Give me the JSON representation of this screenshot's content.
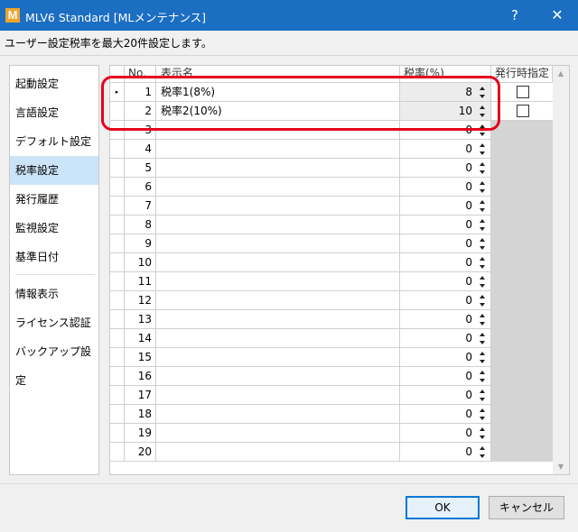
{
  "window": {
    "app_icon": "M",
    "title": "MLV6 Standard [MLメンテナンス]",
    "help": "?",
    "close": "✕"
  },
  "description": "ユーザー設定税率を最大20件設定します。",
  "sidebar": {
    "items": [
      {
        "label": "起動設定",
        "selected": false
      },
      {
        "label": "言語設定",
        "selected": false
      },
      {
        "label": "デフォルト設定",
        "selected": false
      },
      {
        "label": "税率設定",
        "selected": true
      },
      {
        "label": "発行履歴",
        "selected": false
      },
      {
        "label": "監視設定",
        "selected": false
      },
      {
        "label": "基準日付",
        "selected": false
      },
      {
        "label": "情報表示",
        "selected": false
      },
      {
        "label": "ライセンス認証",
        "selected": false
      },
      {
        "label": "バックアップ設定",
        "selected": false
      }
    ]
  },
  "grid": {
    "headers": {
      "no": "No.",
      "name": "表示名",
      "rate": "税率(%)",
      "issue": "発行時指定"
    },
    "current_row_marker": "▸",
    "rows": [
      {
        "no": "1",
        "name": "税率1(8%)",
        "rate": "8"
      },
      {
        "no": "2",
        "name": "税率2(10%)",
        "rate": "10"
      },
      {
        "no": "3",
        "name": "",
        "rate": "0"
      },
      {
        "no": "4",
        "name": "",
        "rate": "0"
      },
      {
        "no": "5",
        "name": "",
        "rate": "0"
      },
      {
        "no": "6",
        "name": "",
        "rate": "0"
      },
      {
        "no": "7",
        "name": "",
        "rate": "0"
      },
      {
        "no": "8",
        "name": "",
        "rate": "0"
      },
      {
        "no": "9",
        "name": "",
        "rate": "0"
      },
      {
        "no": "10",
        "name": "",
        "rate": "0"
      },
      {
        "no": "11",
        "name": "",
        "rate": "0"
      },
      {
        "no": "12",
        "name": "",
        "rate": "0"
      },
      {
        "no": "13",
        "name": "",
        "rate": "0"
      },
      {
        "no": "14",
        "name": "",
        "rate": "0"
      },
      {
        "no": "15",
        "name": "",
        "rate": "0"
      },
      {
        "no": "16",
        "name": "",
        "rate": "0"
      },
      {
        "no": "17",
        "name": "",
        "rate": "0"
      },
      {
        "no": "18",
        "name": "",
        "rate": "0"
      },
      {
        "no": "19",
        "name": "",
        "rate": "0"
      },
      {
        "no": "20",
        "name": "",
        "rate": "0"
      }
    ],
    "issue_checkboxes": [
      false,
      false
    ]
  },
  "buttons": {
    "ok": "OK",
    "cancel": "キャンセル"
  },
  "colors": {
    "titlebar": "#1b6ec2",
    "annotation": "#e4001b",
    "selected_nav": "#cce4f7"
  }
}
